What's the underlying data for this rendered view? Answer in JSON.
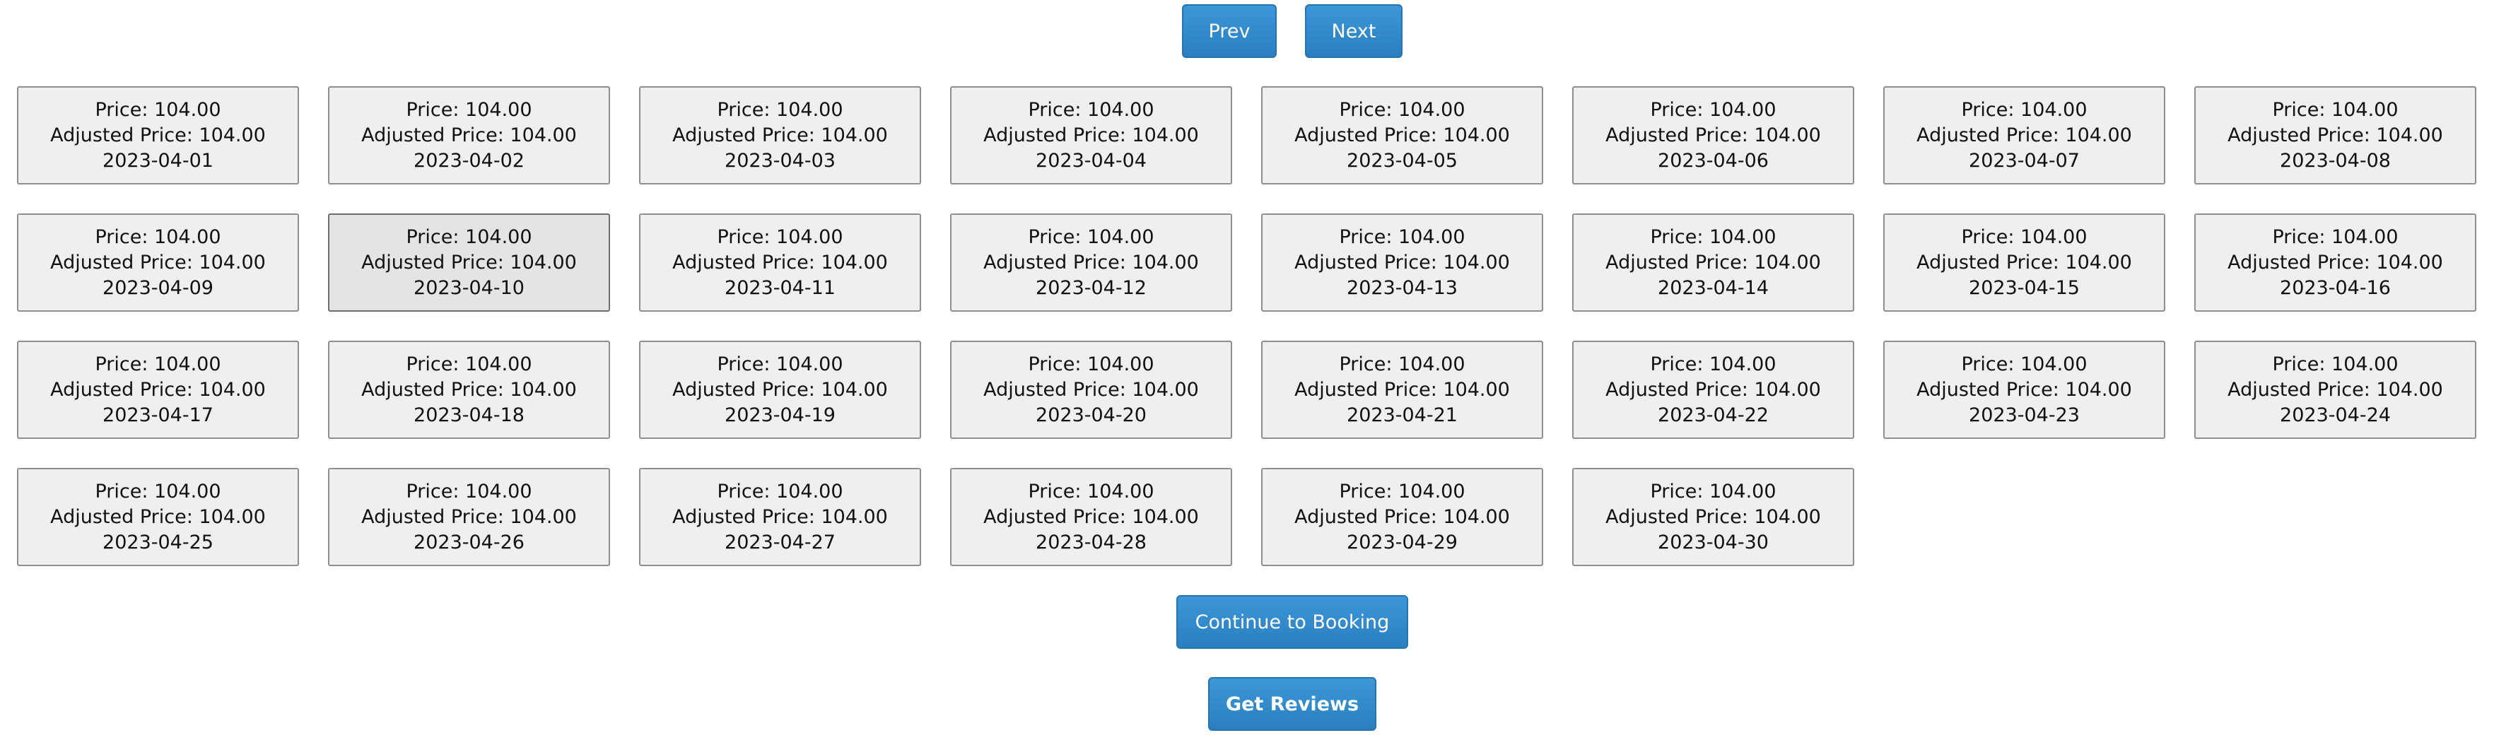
{
  "nav": {
    "prev_label": "Prev",
    "next_label": "Next"
  },
  "cells": [
    {
      "price": "Price: 104.00",
      "adjusted": "Adjusted Price: 104.00",
      "date": "2023-04-01"
    },
    {
      "price": "Price: 104.00",
      "adjusted": "Adjusted Price: 104.00",
      "date": "2023-04-02"
    },
    {
      "price": "Price: 104.00",
      "adjusted": "Adjusted Price: 104.00",
      "date": "2023-04-03"
    },
    {
      "price": "Price: 104.00",
      "adjusted": "Adjusted Price: 104.00",
      "date": "2023-04-04"
    },
    {
      "price": "Price: 104.00",
      "adjusted": "Adjusted Price: 104.00",
      "date": "2023-04-05"
    },
    {
      "price": "Price: 104.00",
      "adjusted": "Adjusted Price: 104.00",
      "date": "2023-04-06"
    },
    {
      "price": "Price: 104.00",
      "adjusted": "Adjusted Price: 104.00",
      "date": "2023-04-07"
    },
    {
      "price": "Price: 104.00",
      "adjusted": "Adjusted Price: 104.00",
      "date": "2023-04-08"
    },
    {
      "price": "Price: 104.00",
      "adjusted": "Adjusted Price: 104.00",
      "date": "2023-04-09"
    },
    {
      "price": "Price: 104.00",
      "adjusted": "Adjusted Price: 104.00",
      "date": "2023-04-10",
      "hover": true
    },
    {
      "price": "Price: 104.00",
      "adjusted": "Adjusted Price: 104.00",
      "date": "2023-04-11"
    },
    {
      "price": "Price: 104.00",
      "adjusted": "Adjusted Price: 104.00",
      "date": "2023-04-12"
    },
    {
      "price": "Price: 104.00",
      "adjusted": "Adjusted Price: 104.00",
      "date": "2023-04-13"
    },
    {
      "price": "Price: 104.00",
      "adjusted": "Adjusted Price: 104.00",
      "date": "2023-04-14"
    },
    {
      "price": "Price: 104.00",
      "adjusted": "Adjusted Price: 104.00",
      "date": "2023-04-15"
    },
    {
      "price": "Price: 104.00",
      "adjusted": "Adjusted Price: 104.00",
      "date": "2023-04-16"
    },
    {
      "price": "Price: 104.00",
      "adjusted": "Adjusted Price: 104.00",
      "date": "2023-04-17"
    },
    {
      "price": "Price: 104.00",
      "adjusted": "Adjusted Price: 104.00",
      "date": "2023-04-18"
    },
    {
      "price": "Price: 104.00",
      "adjusted": "Adjusted Price: 104.00",
      "date": "2023-04-19"
    },
    {
      "price": "Price: 104.00",
      "adjusted": "Adjusted Price: 104.00",
      "date": "2023-04-20"
    },
    {
      "price": "Price: 104.00",
      "adjusted": "Adjusted Price: 104.00",
      "date": "2023-04-21"
    },
    {
      "price": "Price: 104.00",
      "adjusted": "Adjusted Price: 104.00",
      "date": "2023-04-22"
    },
    {
      "price": "Price: 104.00",
      "adjusted": "Adjusted Price: 104.00",
      "date": "2023-04-23"
    },
    {
      "price": "Price: 104.00",
      "adjusted": "Adjusted Price: 104.00",
      "date": "2023-04-24"
    },
    {
      "price": "Price: 104.00",
      "adjusted": "Adjusted Price: 104.00",
      "date": "2023-04-25"
    },
    {
      "price": "Price: 104.00",
      "adjusted": "Adjusted Price: 104.00",
      "date": "2023-04-26"
    },
    {
      "price": "Price: 104.00",
      "adjusted": "Adjusted Price: 104.00",
      "date": "2023-04-27"
    },
    {
      "price": "Price: 104.00",
      "adjusted": "Adjusted Price: 104.00",
      "date": "2023-04-28"
    },
    {
      "price": "Price: 104.00",
      "adjusted": "Adjusted Price: 104.00",
      "date": "2023-04-29"
    },
    {
      "price": "Price: 104.00",
      "adjusted": "Adjusted Price: 104.00",
      "date": "2023-04-30"
    }
  ],
  "actions": {
    "continue_label": "Continue to Booking",
    "reviews_label": "Get Reviews"
  },
  "colors": {
    "button_blue": "#2f86c9",
    "cell_background": "#efefef",
    "cell_border": "#8e8e8e"
  }
}
